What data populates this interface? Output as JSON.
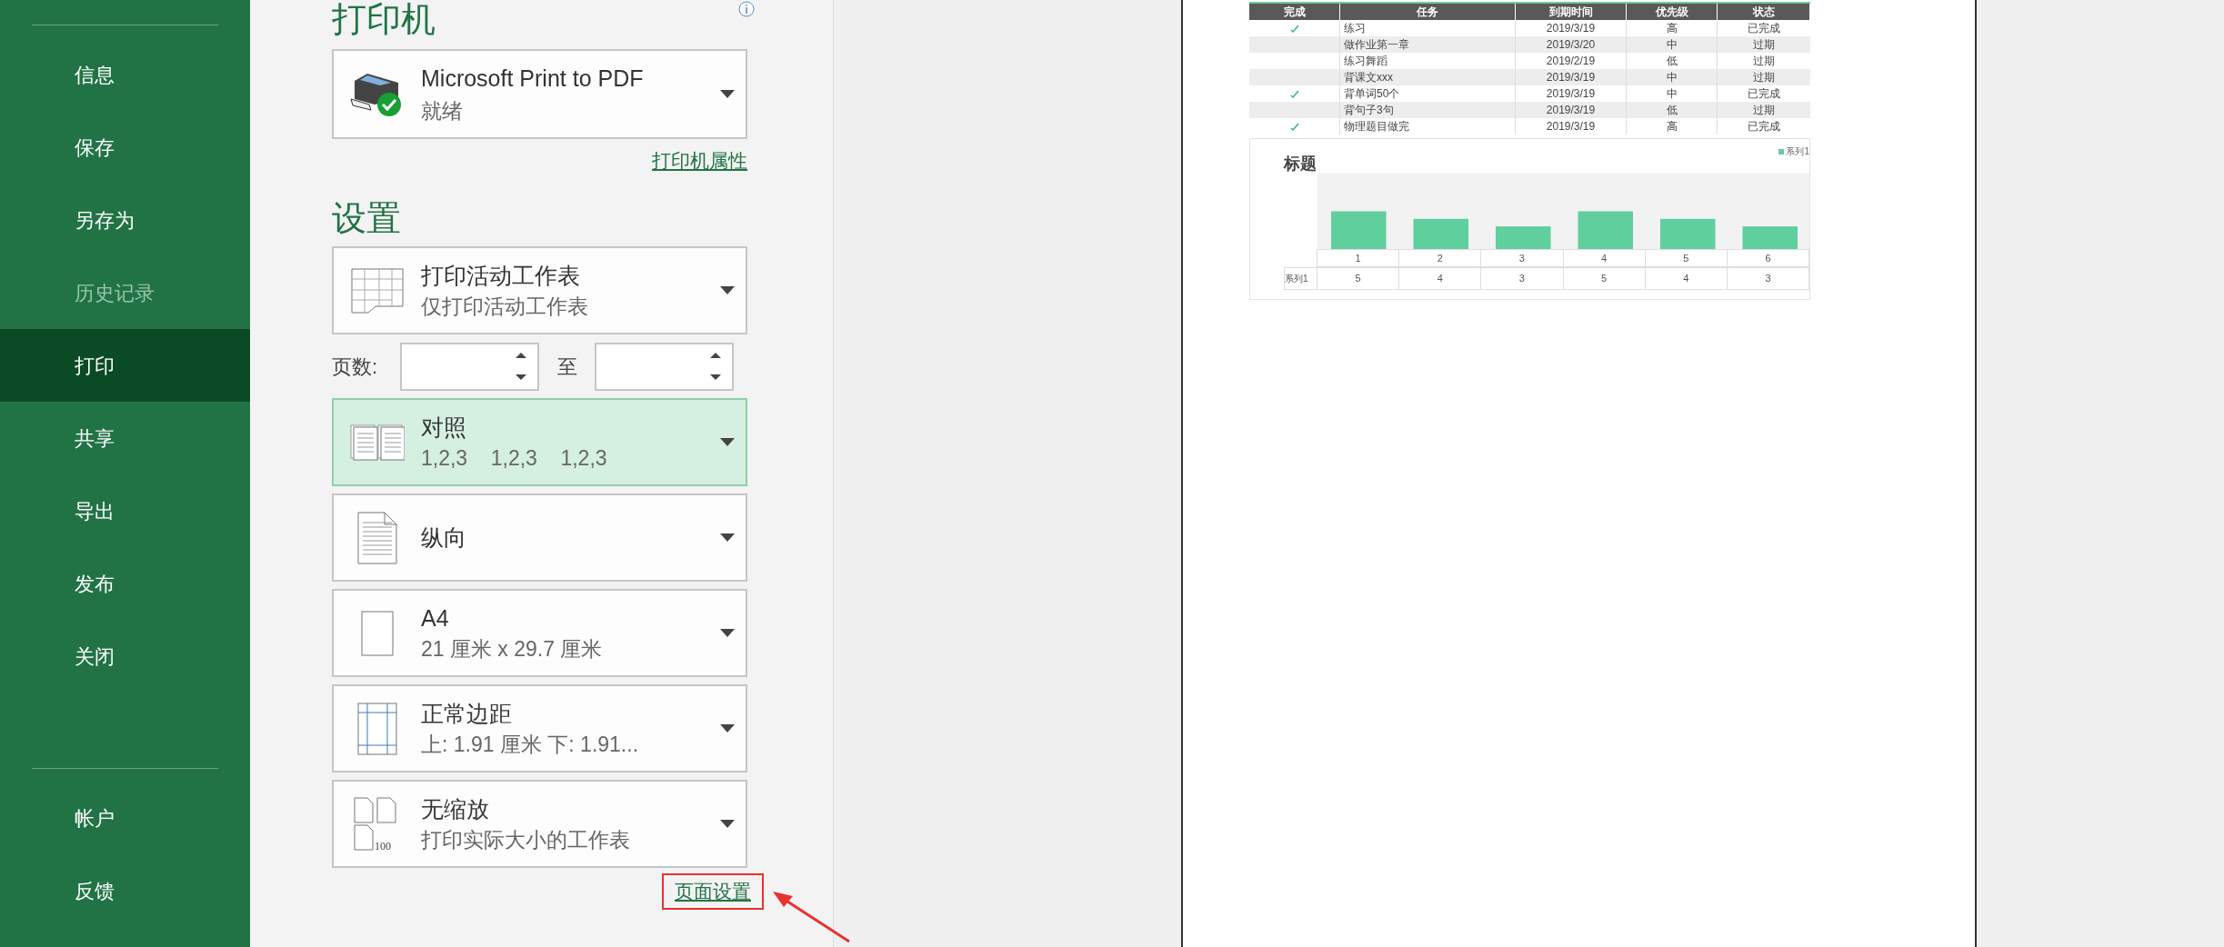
{
  "sidebar": {
    "items": [
      {
        "label": "信息",
        "selected": false,
        "disabled": false
      },
      {
        "label": "保存",
        "selected": false,
        "disabled": false
      },
      {
        "label": "另存为",
        "selected": false,
        "disabled": false
      },
      {
        "label": "历史记录",
        "selected": false,
        "disabled": true
      },
      {
        "label": "打印",
        "selected": true,
        "disabled": false
      },
      {
        "label": "共享",
        "selected": false,
        "disabled": false
      },
      {
        "label": "导出",
        "selected": false,
        "disabled": false
      },
      {
        "label": "发布",
        "selected": false,
        "disabled": false
      },
      {
        "label": "关闭",
        "selected": false,
        "disabled": false
      }
    ],
    "bottom_items": [
      {
        "label": "帐户",
        "selected": false,
        "disabled": false
      },
      {
        "label": "反馈",
        "selected": false,
        "disabled": false
      }
    ]
  },
  "printer": {
    "heading": "打印机",
    "name": "Microsoft Print to PDF",
    "status": "就绪",
    "properties_link": "打印机属性"
  },
  "settings": {
    "heading": "设置",
    "items": [
      {
        "kind": "sheet",
        "title": "打印活动工作表",
        "subtitle": "仅打印活动工作表",
        "highlighted": false
      },
      {
        "kind": "pages",
        "label": "页数:",
        "to_label": "至"
      },
      {
        "kind": "collate",
        "title": "对照",
        "subtitle": "1,2,3    1,2,3    1,2,3",
        "highlighted": true
      },
      {
        "kind": "portrait",
        "title": "纵向",
        "highlighted": false
      },
      {
        "kind": "paper",
        "title": "A4",
        "subtitle": "21 厘米 x 29.7 厘米",
        "highlighted": false
      },
      {
        "kind": "margins",
        "title": "正常边距",
        "subtitle": "上: 1.91 厘米 下: 1.91...",
        "highlighted": false
      },
      {
        "kind": "scaling",
        "scale_label": "100",
        "title": "无缩放",
        "subtitle": "打印实际大小的工作表",
        "highlighted": false
      }
    ],
    "page_setup_link": {
      "label": "页面设置",
      "annotated": true
    }
  },
  "preview": {
    "table": {
      "columns": [
        "完成",
        "任务",
        "到期时间",
        "优先级",
        "状态"
      ],
      "rows": [
        {
          "done": true,
          "task": "练习",
          "due": "2019/3/19",
          "priority": "高",
          "status": "已完成"
        },
        {
          "done": false,
          "task": "做作业第一章",
          "due": "2019/3/20",
          "priority": "中",
          "status": "过期"
        },
        {
          "done": false,
          "task": "练习舞蹈",
          "due": "2019/2/19",
          "priority": "低",
          "status": "过期"
        },
        {
          "done": false,
          "task": "背课文xxx",
          "due": "2019/3/19",
          "priority": "中",
          "status": "过期"
        },
        {
          "done": true,
          "task": "背单词50个",
          "due": "2019/3/19",
          "priority": "中",
          "status": "已完成"
        },
        {
          "done": false,
          "task": "背句子3句",
          "due": "2019/3/19",
          "priority": "低",
          "status": "过期"
        },
        {
          "done": true,
          "task": "物理题目做完",
          "due": "2019/3/19",
          "priority": "高",
          "status": "已完成"
        }
      ]
    },
    "chart_data": {
      "type": "bar",
      "title": "标题",
      "categories": [
        "1",
        "2",
        "3",
        "4",
        "5",
        "6"
      ],
      "series": [
        {
          "name": "系列1",
          "color": "#5fcf9e",
          "values": [
            5,
            4,
            3,
            5,
            4,
            3
          ]
        }
      ],
      "ylim": [
        0,
        10
      ],
      "data_labels": true
    }
  }
}
